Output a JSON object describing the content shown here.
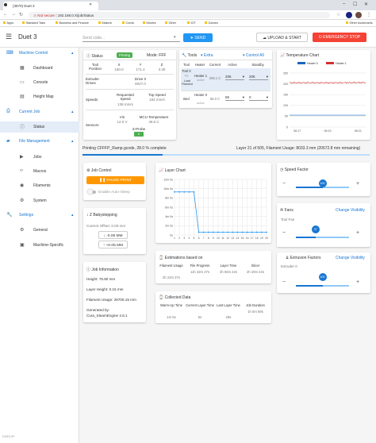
{
  "browser": {
    "tab_title": "(3570) Duet 3",
    "security": "Not secure",
    "url": "192.168.0.X/job/Status",
    "bookmarks": [
      "Apps",
      "Standard Tabs",
      "Business and Finance",
      "Makers",
      "Comic",
      "Movies",
      "Other",
      "IOT",
      "Games"
    ],
    "other_bookmarks": "Other bookmarks"
  },
  "header": {
    "title": "Duet 3",
    "send_placeholder": "Send code...",
    "send_label": "SEND",
    "upload_label": "UPLOAD & START",
    "estop_label": "EMERGENCY STOP"
  },
  "sidebar": {
    "machine_control": "Machine Control",
    "dashboard": "Dashboard",
    "console": "Console",
    "height_map": "Height Map",
    "current_job": "Current Job",
    "status": "Status",
    "file_management": "File Management",
    "jobs": "Jobs",
    "macros": "Macros",
    "filaments": "Filaments",
    "system": "System",
    "settings": "Settings",
    "general": "General",
    "machine_specific": "Machine-Specific"
  },
  "status_card": {
    "title": "Status",
    "badge": "Printing",
    "mode": "Mode: FFF",
    "tool_position": "Tool Position",
    "x_label": "X",
    "x_value": "150.0",
    "y_label": "Y",
    "y_value": "171.4",
    "z_label": "Z",
    "z_value": "3.30",
    "extruder_drives": "Extruder Drives",
    "drive_label": "Drive 0",
    "drive_value": "8027.0",
    "speeds": "Speeds",
    "requested_label": "Requested Speed",
    "requested_value": "138 mm/s",
    "top_label": "Top Speed",
    "top_value": "182 mm/s",
    "sensors": "Sensors",
    "vin_label": "Vin",
    "vin_value": "12.0 V",
    "mcu_label": "MCU Temperature",
    "mcu_value": "49.6 C",
    "zprobe_label": "Z-Probe",
    "zprobe_value": "0"
  },
  "tools_card": {
    "title": "Tools",
    "extra": "Extra",
    "control_all": "Control All",
    "col_tool": "Tool",
    "col_heater": "Heater",
    "col_current": "Current",
    "col_active": "Active",
    "col_standby": "Standby",
    "tool_name": "Tool 0",
    "tool_sub": "T0",
    "load_filament": "Load Filament",
    "heater": "Heater 1",
    "heater_state": "active",
    "current_temp": "206.1 C",
    "active_temp": "205",
    "standby_temp": "205",
    "bed_label": "Bed",
    "bed_heater": "Heater 0",
    "bed_state": "active",
    "bed_current": "55.0 C",
    "bed_active": "55",
    "bed_standby": "0"
  },
  "temp_chart": {
    "title": "Temperature Chart",
    "legend": [
      "Heater 0",
      "Heater 1"
    ],
    "yticks": [
      "250",
      "200",
      "150",
      "100",
      "50",
      "0"
    ],
    "xticks": [
      "06:17",
      "06:19",
      "06:21"
    ]
  },
  "progress": {
    "text": "Printing CFFFP_Ramp.gcode, 28.0 % complete",
    "percent": 28,
    "layer_text": "Layer 21 of 505, Filament Usage: 8033.3 mm (20672.8 mm remaining)"
  },
  "job_control": {
    "title": "Job Control",
    "pause_label": "PAUSE PRINT",
    "auto_sleep": "Enable Auto-Sleep"
  },
  "babystep": {
    "title": "Z Babystepping",
    "offset": "Current Offset: 0.00 mm",
    "minus": "-0.05 MM",
    "plus": "+0.05 MM"
  },
  "job_info": {
    "title": "Job Information",
    "height": "Height: 75.80 mm",
    "layer_height": "Layer Height: 0.15 mm",
    "filament_usage": "Filament Usage: 28706.15 mm",
    "generated_by": "Generated by:",
    "generator": "Cura_SteamEngine 4.6.1"
  },
  "layer_chart": {
    "title": "Layer Chart",
    "yticks": [
      "12m 0s",
      "10m 0s",
      "8m 0s",
      "6m 0s",
      "4m 0s",
      "2m 0s",
      "0s"
    ],
    "xticks": [
      "1",
      "2",
      "3",
      "4",
      "5",
      "6",
      "7",
      "8",
      "9",
      "10",
      "11",
      "12",
      "13",
      "14",
      "15",
      "16",
      "17",
      "18",
      "19",
      "20"
    ]
  },
  "chart_data": [
    {
      "type": "line",
      "title": "Layer Chart",
      "x": [
        1,
        2,
        3,
        4,
        5,
        6,
        7,
        8,
        9,
        10,
        11,
        12,
        13,
        14,
        15,
        16,
        17,
        18,
        19,
        20
      ],
      "series": [
        {
          "values": [
            9.3,
            9.3,
            9.3,
            9.3,
            9.3,
            0.6,
            0.6,
            0.6,
            0.6,
            0.6,
            0.6,
            0.6,
            0.6,
            0.6,
            0.6,
            0.6,
            0.6,
            0.6,
            0.6,
            0.6
          ]
        }
      ],
      "ylim": [
        0,
        12
      ]
    },
    {
      "type": "line",
      "title": "Temperature Chart",
      "x": [
        "06:17",
        "06:19",
        "06:21"
      ],
      "series": [
        {
          "name": "Heater 0",
          "values": [
            55,
            55,
            55
          ]
        },
        {
          "name": "Heater 1",
          "values": [
            205,
            205,
            206
          ]
        }
      ],
      "ylim": [
        0,
        250
      ]
    }
  ],
  "estimations": {
    "title": "Estimations based on",
    "filament_usage_label": "Filament Usage",
    "filament_usage_value": "2h 22m 37s",
    "file_progress_label": "File Progress",
    "file_progress_value": "11h 42m 27s",
    "layer_time_label": "Layer Time",
    "layer_time_value": "3h 56m 22s",
    "slicer_label": "Slicer",
    "slicer_value": "2h 20m 44s"
  },
  "collected": {
    "title": "Collected Data",
    "warmup_label": "Warm-Up Time",
    "warmup_value": "1m 5s",
    "current_layer_label": "Current Layer Time",
    "current_layer_value": "5s",
    "last_layer_label": "Last Layer Time",
    "last_layer_value": "29s",
    "job_duration_label": "Job Duration",
    "job_duration_value": "1h 5m 59s"
  },
  "speed_factor": {
    "title": "Speed Factor",
    "value": "100",
    "fraction": 0.5
  },
  "fans": {
    "title": "Fans",
    "change_visibility": "Change Visibility",
    "tool_fan": "Tool Fan",
    "value": "37",
    "fraction": 0.37
  },
  "extrusion": {
    "title": "Extrusion Factors",
    "change_visibility": "Change Visibility",
    "extruder": "Extruder 0",
    "value": "100",
    "fraction": 0.5
  },
  "footer": {
    "text": "DUE3.0P"
  }
}
